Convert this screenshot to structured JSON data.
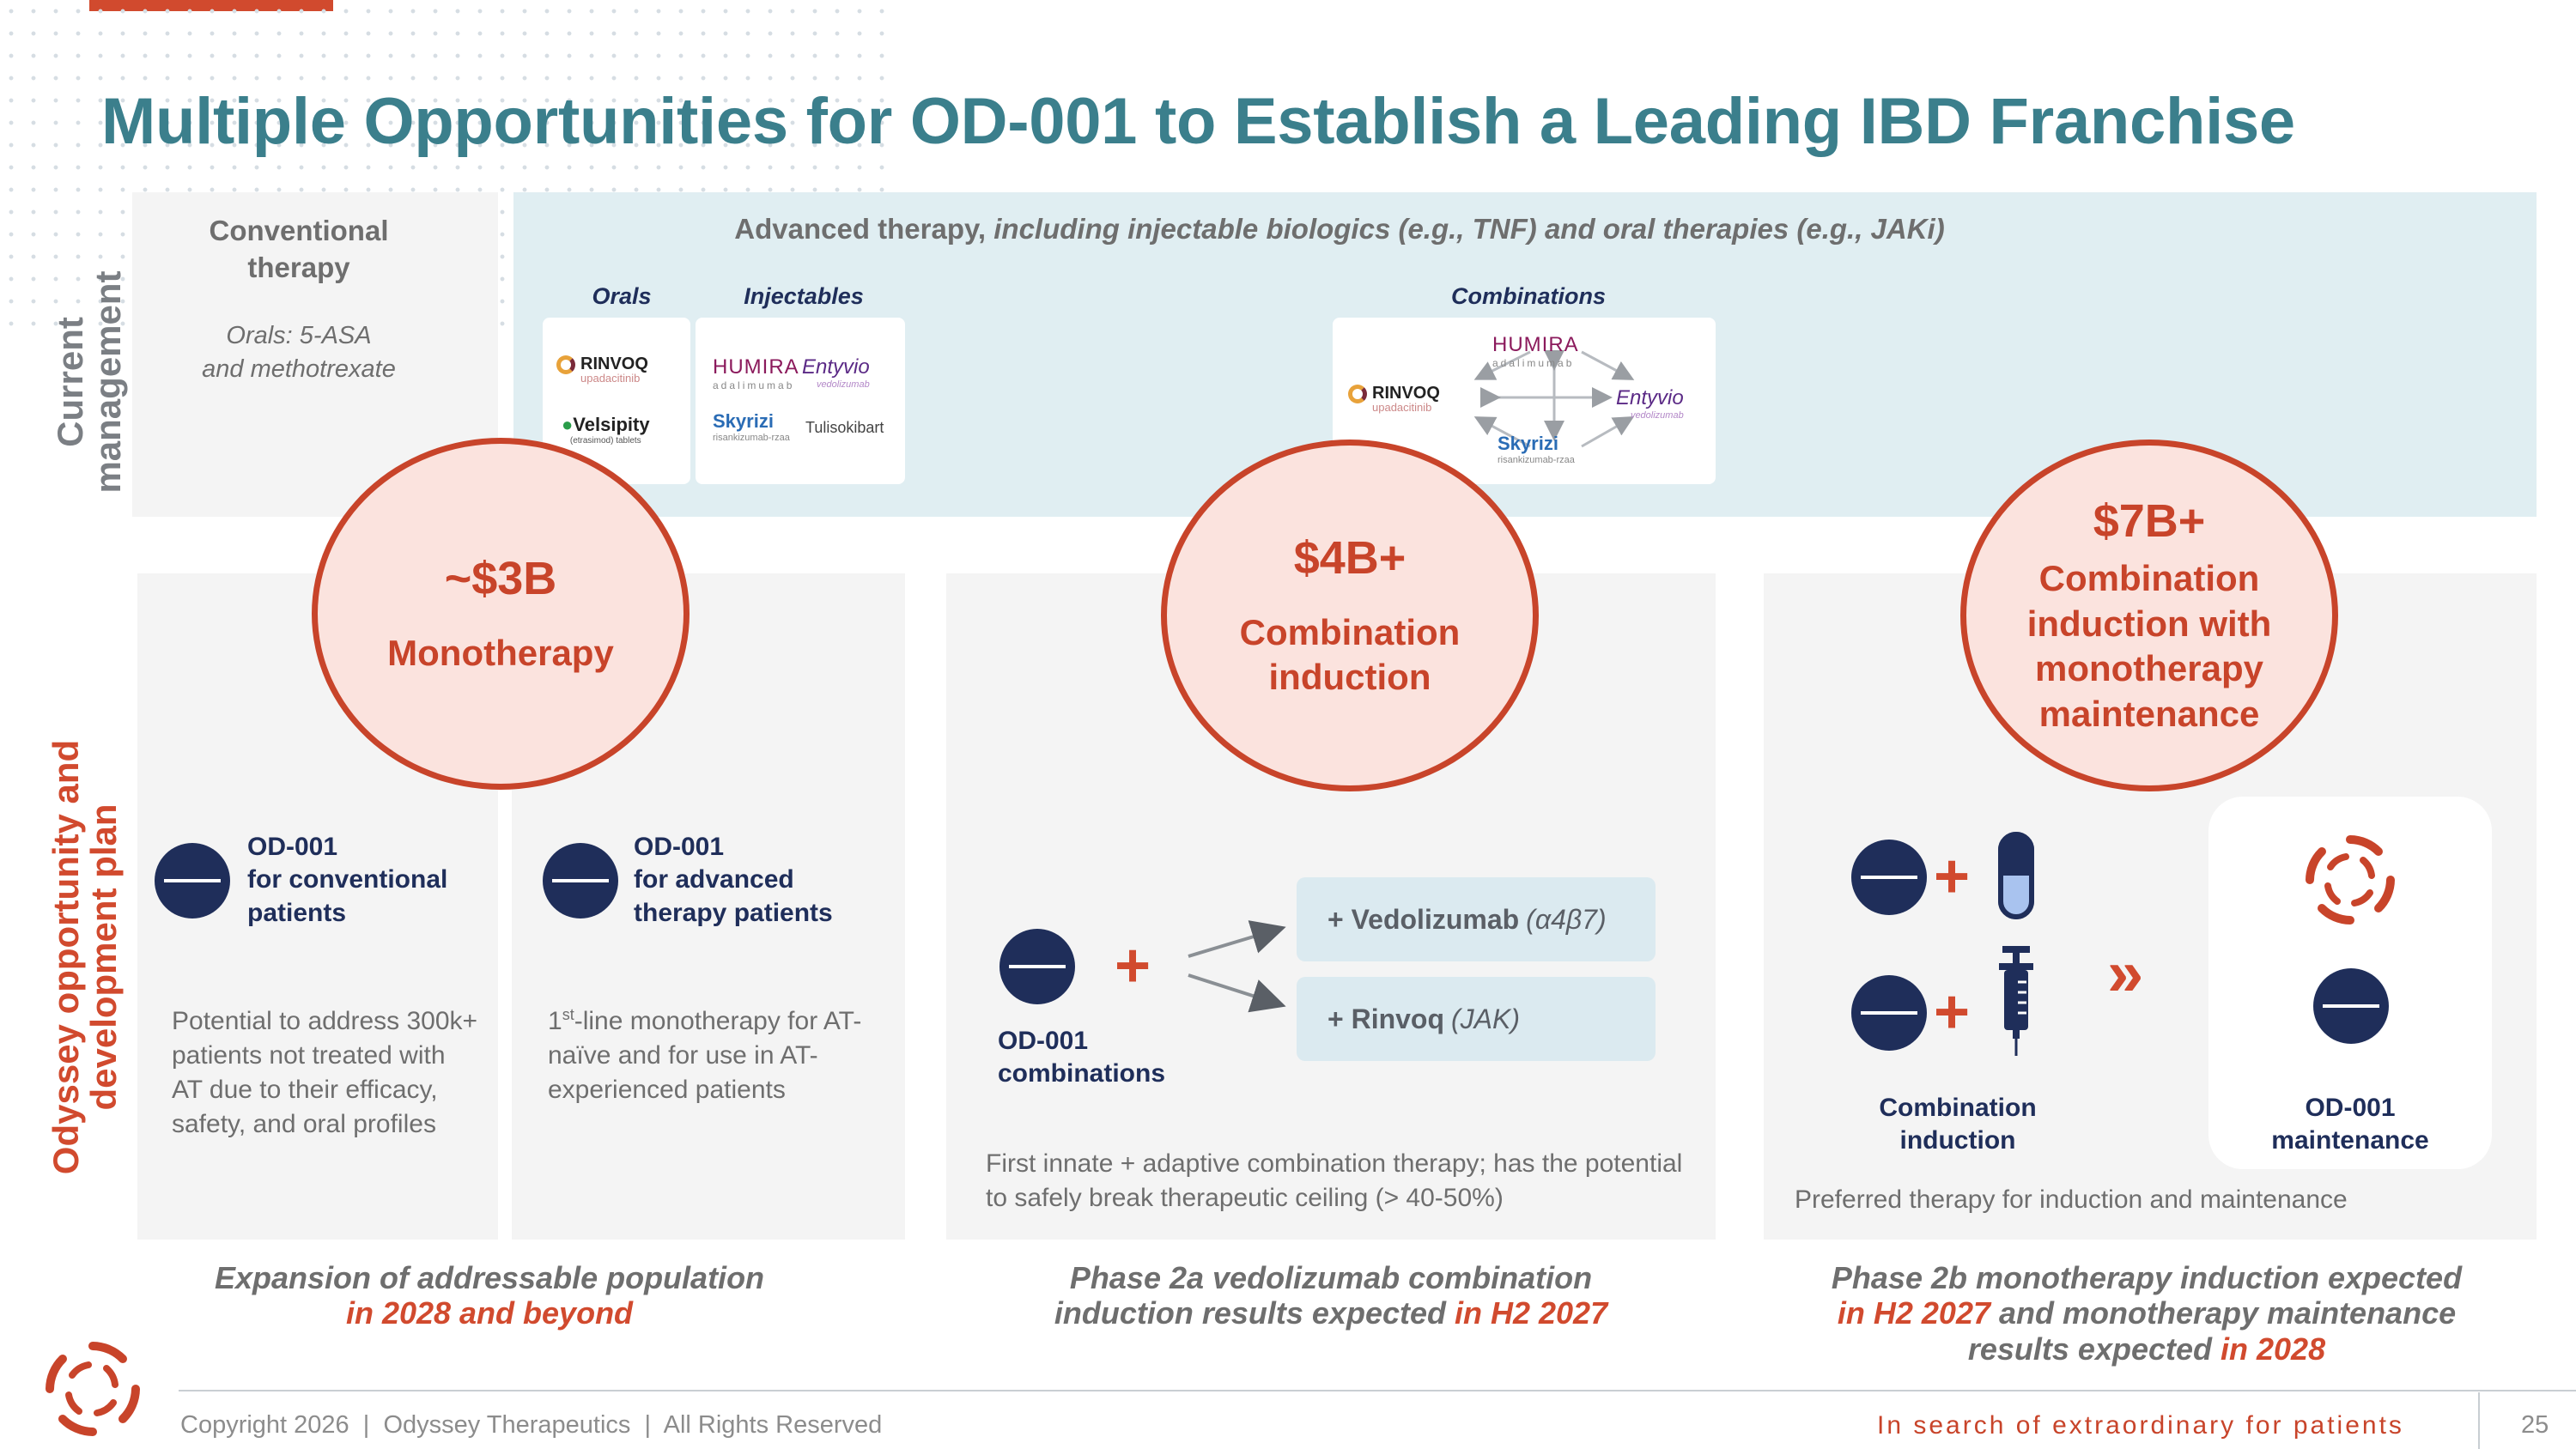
{
  "title": "Multiple Opportunities for OD-001 to Establish a Leading IBD Franchise",
  "side_labels": {
    "current_line1": "Current",
    "current_line2": "management",
    "odyssey_line1": "Odyssey opportunity and",
    "odyssey_line2": "development plan"
  },
  "current_management": {
    "conventional_heading": "Conventional therapy",
    "conventional_sub_line1": "Orals: 5-ASA",
    "conventional_sub_line2": "and methotrexate",
    "advanced_heading_plain": "Advanced therapy,",
    "advanced_heading_italic": "including injectable biologics (e.g., TNF) and oral therapies (e.g., JAKi)",
    "orals_label": "Orals",
    "injectables_label": "Injectables",
    "combinations_label": "Combinations"
  },
  "logos": {
    "rinvoq": "RINVOQ",
    "rinvoq_sub": "upadacitinib",
    "velsipity": "Velsipity",
    "velsipity_sub": "(etrasimod) tablets",
    "humira": "HUMIRA",
    "humira_sub": "adalimumab",
    "entyvio": "Entyvio",
    "entyvio_sub": "vedolizumab",
    "skyrizi": "Skyrizi",
    "skyrizi_sub": "risankizumab-rzaa",
    "tulisokibart": "Tulisokibart"
  },
  "opportunities": [
    {
      "amount": "~$3B",
      "label": "Monotherapy"
    },
    {
      "amount": "$4B+",
      "label": "Combination induction"
    },
    {
      "amount": "$7B+",
      "label": "Combination induction with monotherapy maintenance"
    }
  ],
  "panel1": {
    "od_conv_line1": "OD-001",
    "od_conv_line2": "for conventional",
    "od_conv_line3": "patients",
    "od_adv_line1": "OD-001",
    "od_adv_line2": "for advanced",
    "od_adv_line3": "therapy patients",
    "desc_conv": "Potential to address 300k+ patients not treated with AT due to their efficacy, safety, and oral profiles",
    "desc_adv_sup": "st",
    "desc_adv_pre": "1",
    "desc_adv_rest": "-line monotherapy for AT-naïve and for use in AT-experienced patients"
  },
  "panel2": {
    "od_comb_line1": "OD-001",
    "od_comb_line2": "combinations",
    "box1_main": "+ Vedolizumab",
    "box1_italic": "(α4β7)",
    "box2_main": "+ Rinvoq",
    "box2_italic": "(JAK)",
    "desc": "First innate + adaptive combination therapy; has the potential to safely break therapeutic ceiling (> 40-50%)"
  },
  "panel3": {
    "comb_ind_line1": "Combination",
    "comb_ind_line2": "induction",
    "od_maint_line1": "OD-001",
    "od_maint_line2": "maintenance",
    "arrow": "»",
    "desc": "Preferred therapy for induction and maintenance"
  },
  "bottom_notes": {
    "n1_line1": "Expansion of addressable population",
    "n1_line2_hl": "in 2028 and beyond",
    "n2_line1": "Phase 2a vedolizumab combination",
    "n2_line2_pre": "induction results expected ",
    "n2_line2_hl": "in H2 2027",
    "n3_line1": "Phase 2b monotherapy induction expected",
    "n3_line2_hl": "in H2 2027",
    "n3_line2_post": " and monotherapy maintenance",
    "n3_line3_pre": "results expected ",
    "n3_line3_hl": "in 2028"
  },
  "footer": {
    "copyright": "Copyright 2026  |  Odyssey Therapeutics  |  All Rights Reserved",
    "tagline": "In search of extraordinary for patients",
    "page": "25"
  },
  "colors": {
    "accent": "#d14a2e",
    "title_teal": "#3b7f8c",
    "navy": "#1f2e5a",
    "panel_gray": "#f4f4f4",
    "current_blue": "#e0eef2"
  }
}
